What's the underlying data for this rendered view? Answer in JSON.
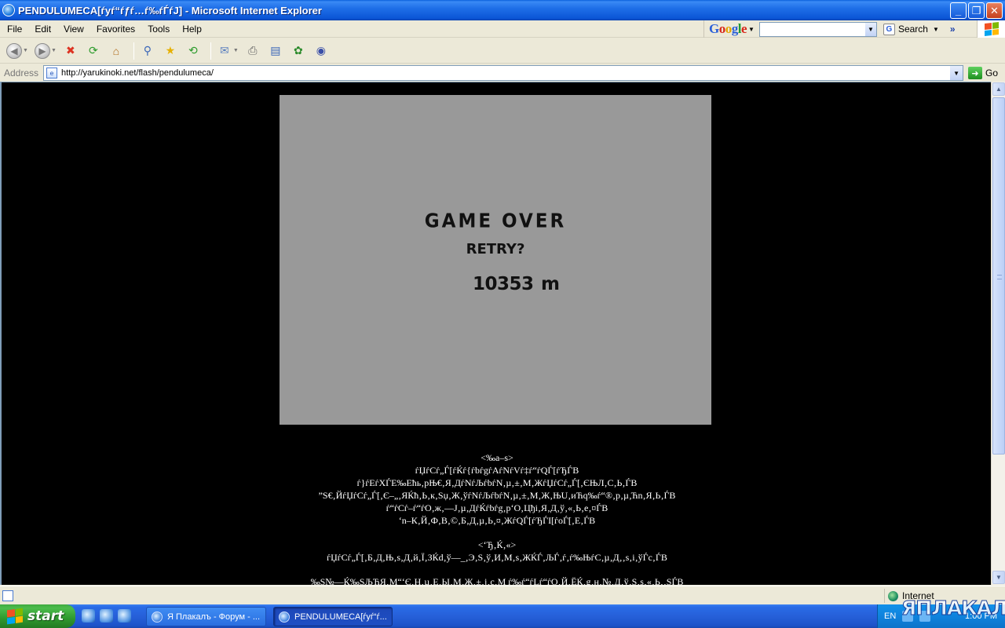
{
  "window": {
    "title": "PENDULUMECA[ѓуѓ“ѓƒѓ…ѓ‰ѓЃѓJ] - Microsoft Internet Explorer",
    "controls": [
      "_",
      "❐",
      "✕"
    ]
  },
  "menubar": {
    "items": [
      "File",
      "Edit",
      "View",
      "Favorites",
      "Tools",
      "Help"
    ]
  },
  "google_toolbar": {
    "search_label": "Search",
    "search_value": "",
    "more": "»"
  },
  "toolbar": {
    "buttons": [
      "back",
      "forward",
      "stop",
      "refresh",
      "home",
      "search",
      "favorites",
      "history",
      "mail",
      "print",
      "edit",
      "messenger",
      "research"
    ]
  },
  "address": {
    "label": "Address",
    "url": "http://yarukinoki.net/flash/pendulumeca/",
    "go_label": "Go"
  },
  "game": {
    "title": "GAME OVER",
    "retry": "RETRY?",
    "distance": "10353",
    "unit": "m",
    "background": "#999999"
  },
  "page_text": {
    "lines_block1": [
      "<‰а–ѕ>",
      "ѓЏѓCѓ„Ѓ[ѓЌѓ{ѓbѓgѓAѓNѓVѓ‡ѓ“ѓQЃ[ѓЂЃB",
      "ѓ}ѓEѓXЃE‰Ећь‚рЊ€‚Я‚ДѓNѓЉѓbѓN‚µ‚±‚М‚ЖѓЏѓCѓ„Ѓ[‚ЄЊЛ‚C‚Ь‚ЃB",
      "”Ѕ€‚ЙѓЏѓCѓ„Ѓ[‚Є–„‚ЯЌћ‚Ь‚к‚Sџ‚Ж‚ўѓNѓЉѓbѓN‚µ‚±‚М‚Ж‚ЊU‚иЋq‰ѓ“®‚р‚µ‚Ћn‚Я‚Ь‚ЃB",
      "ѓ“ѓCѓ–ѓ“ѓO‚ж‚—Ј‚µ‚ДѓЌѓbѓg‚р‘O‚Цђi‚Я‚Д‚ў‚«‚Ь‚е‚¤ЃB",
      "‘n–К‚Й‚Ф‚В‚©‚Б‚Д‚µ‚Ь‚¤‚ЖѓQЃ[ѓЂЃI[ѓoЃ[‚Е‚ЃB"
    ],
    "lines_block2": [
      "<‘Ђ‚Ќ‚«>",
      "ѓЏѓCѓ„Ѓ[‚Б‚Д‚Њ‚ѕ‚Д‚й‚Ї‚ЗЌd‚ў—_‚Э‚S‚ў‚И‚М‚s‚ЖЌЃ‚ЉЃ‚ѓ‚ѓ‰ЊѓC‚µ‚Д‚‚s‚і‚ўЃc‚ЃB",
      "‰Ѕ№—Ќ‰ЅЉЋЯ‚М“‘Є‚Н‚µ‚Е‚Ы‚М‚Ж‚±‚j‚c‚М ѓ‰ѓ“ѓLѓ“ѓO‚Й‚ЁЌ‚g‚н‚№‚Д‚ў‚Ѕ‚ѕ‚«‚Ь‚‚SЃB"
    ]
  },
  "statusbar": {
    "text": "",
    "zone": "Internet"
  },
  "taskbar": {
    "start_label": "start",
    "tasks": [
      "Я Плакалъ - Форум - ...",
      "PENDULUMECA[ѓуѓ“ѓ..."
    ],
    "tray_lang": "EN",
    "clock": "1:00 PM"
  },
  "watermark": "ЯПЛАКАЛЪ"
}
